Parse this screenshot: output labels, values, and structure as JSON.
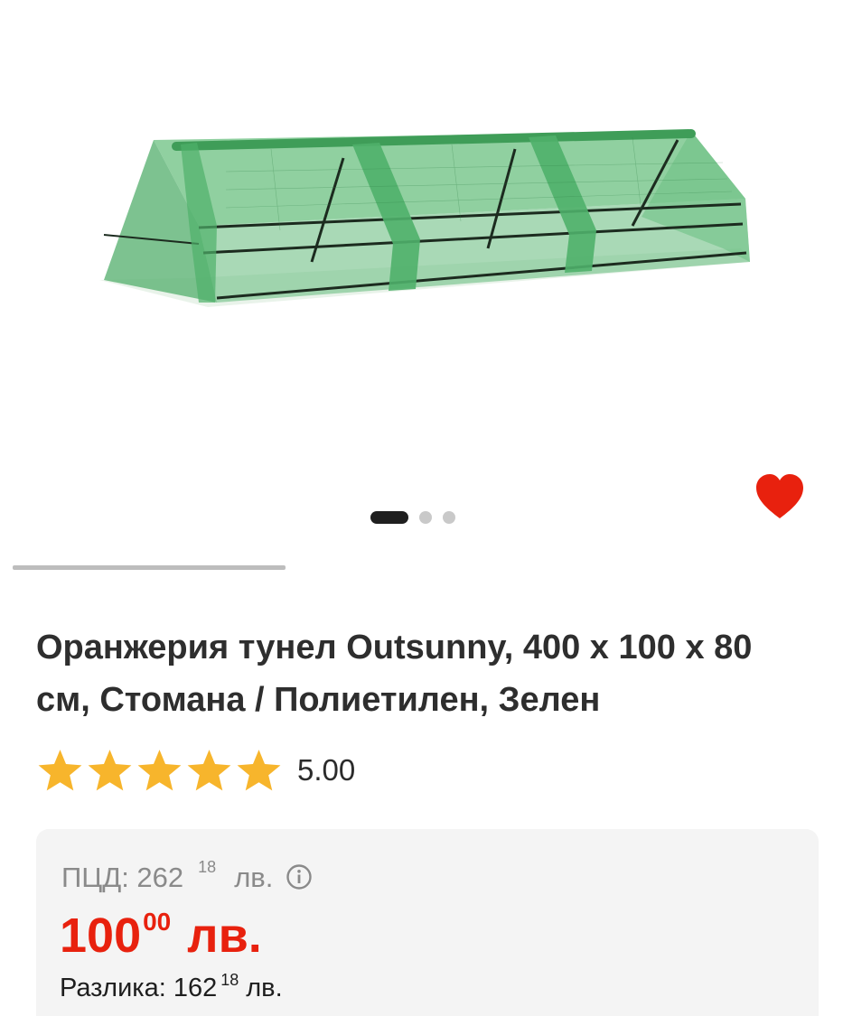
{
  "product": {
    "title": "Оранжерия тунел Outsunny, 400 х 100 х 80 см, Стомана / Полиетилен, Зелен",
    "image_icon": "greenhouse-tunnel-photo",
    "favorite_icon": "heart-icon",
    "favorite_active": true,
    "gallery": {
      "count": 3,
      "active_index": 0
    }
  },
  "rating": {
    "value_label": "5.00",
    "value": 5.0,
    "max": 5,
    "star_icon": "star-icon",
    "star_color": "#f7b52c"
  },
  "pricing": {
    "rrp_label": "ПЦД: 262",
    "rrp_decimals": "18",
    "rrp_currency": "лв.",
    "info_icon": "info-icon",
    "price_integer": "100",
    "price_decimals": "00",
    "price_currency": "лв.",
    "difference_label": "Разлика: 162",
    "difference_decimals": "18",
    "difference_currency": "лв."
  },
  "colors": {
    "accent_red": "#e8210e",
    "heart_red": "#e8210e",
    "price_box_bg": "#f4f4f4"
  }
}
